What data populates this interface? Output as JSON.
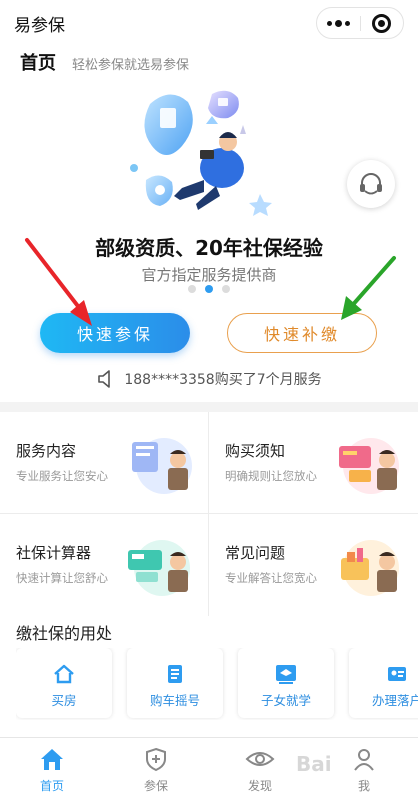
{
  "app": {
    "title": "易参保"
  },
  "header": {
    "title": "首页",
    "subtitle": "轻松参保就选易参保"
  },
  "banner": {
    "title": "部级资质、20年社保经验",
    "subtitle": "官方指定服务提供商",
    "dots_count": 3,
    "active_dot": 2
  },
  "actions": {
    "quick_insure": "快速参保",
    "quick_pay": "快速补缴"
  },
  "notice": {
    "text": "188****3358购买了7个月服务",
    "icon": "speaker-icon"
  },
  "services": [
    {
      "title": "服务内容",
      "desc": "专业服务让您安心"
    },
    {
      "title": "购买须知",
      "desc": "明确规则让您放心"
    },
    {
      "title": "社保计算器",
      "desc": "快速计算让您舒心"
    },
    {
      "title": "常见问题",
      "desc": "专业解答让您宽心"
    }
  ],
  "uses": {
    "title": "缴社保的用处",
    "items": [
      {
        "label": "买房",
        "icon": "house-icon"
      },
      {
        "label": "购车摇号",
        "icon": "document-icon"
      },
      {
        "label": "子女就学",
        "icon": "graduation-cap-icon"
      },
      {
        "label": "办理落户",
        "icon": "id-card-icon"
      }
    ]
  },
  "tabbar": {
    "items": [
      {
        "label": "首页",
        "icon": "home-icon",
        "active": true
      },
      {
        "label": "参保",
        "icon": "shield-plus-icon",
        "active": false
      },
      {
        "label": "发现",
        "icon": "eye-icon",
        "active": false
      },
      {
        "label": "我",
        "icon": "user-icon",
        "active": false
      }
    ]
  },
  "watermark": {
    "text": "Bai"
  },
  "colors": {
    "primary": "#2e9cf0",
    "gradient_start": "#1fb8f4",
    "gradient_end": "#2b8de9",
    "accent_orange": "#e08a2b",
    "arrow_red": "#e8252a",
    "arrow_green": "#2aa52a"
  }
}
